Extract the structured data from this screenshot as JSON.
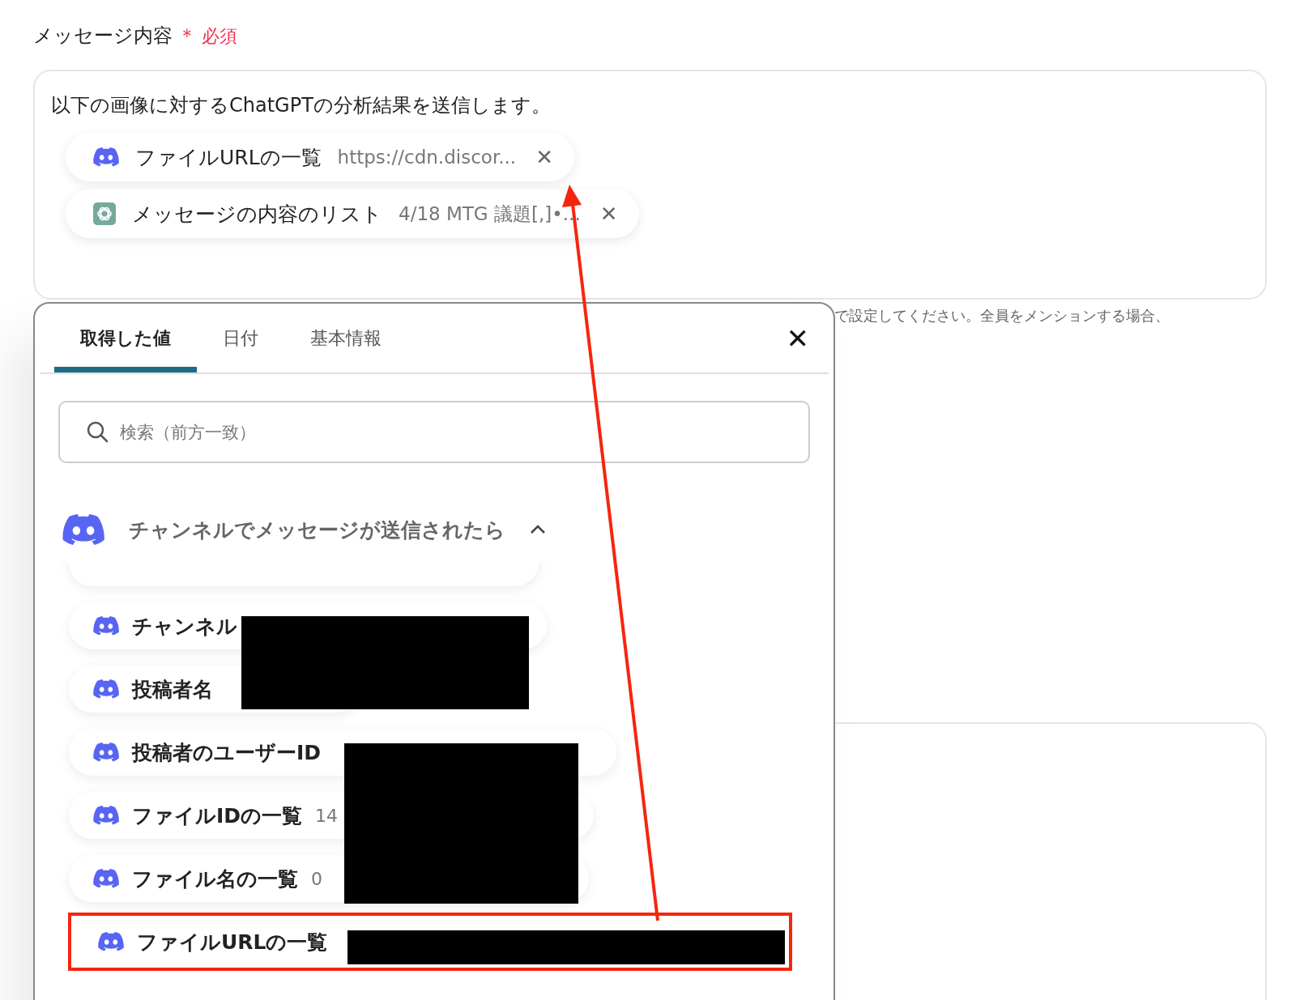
{
  "field": {
    "label": "メッセージ内容",
    "required_mark": "＊",
    "required_text": "必須",
    "text": "以下の画像に対するChatGPTの分析結果を送信します。",
    "chips": [
      {
        "kind": "discord",
        "label": "ファイルURLの一覧",
        "value": "https://cdn.discor...",
        "close": "✕"
      },
      {
        "kind": "chatgpt",
        "label": "メッセージの内容のリスト",
        "value": "4/18 MTG 議題[,]•...",
        "close": "✕"
      }
    ],
    "helper": "で設定してください。全員をメンションする場合、"
  },
  "popup": {
    "tabs": [
      {
        "label": "取得した値",
        "selected": true
      },
      {
        "label": "日付",
        "selected": false
      },
      {
        "label": "基本情報",
        "selected": false
      }
    ],
    "close": "✕",
    "search": {
      "placeholder": "検索（前方一致）"
    },
    "group": {
      "title": "チャンネルでメッセージが送信されたら",
      "expanded": true
    },
    "items": [
      {
        "label": "チャンネル",
        "highlighted": false
      },
      {
        "label": "投稿者名",
        "highlighted": false
      },
      {
        "label": "投稿者のユーザーID",
        "highlighted": false
      },
      {
        "label": "ファイルIDの一覧",
        "value": "14",
        "highlighted": false
      },
      {
        "label": "ファイル名の一覧",
        "value": "0",
        "highlighted": false
      },
      {
        "label": "ファイルURLの一覧",
        "highlighted": true
      }
    ]
  }
}
